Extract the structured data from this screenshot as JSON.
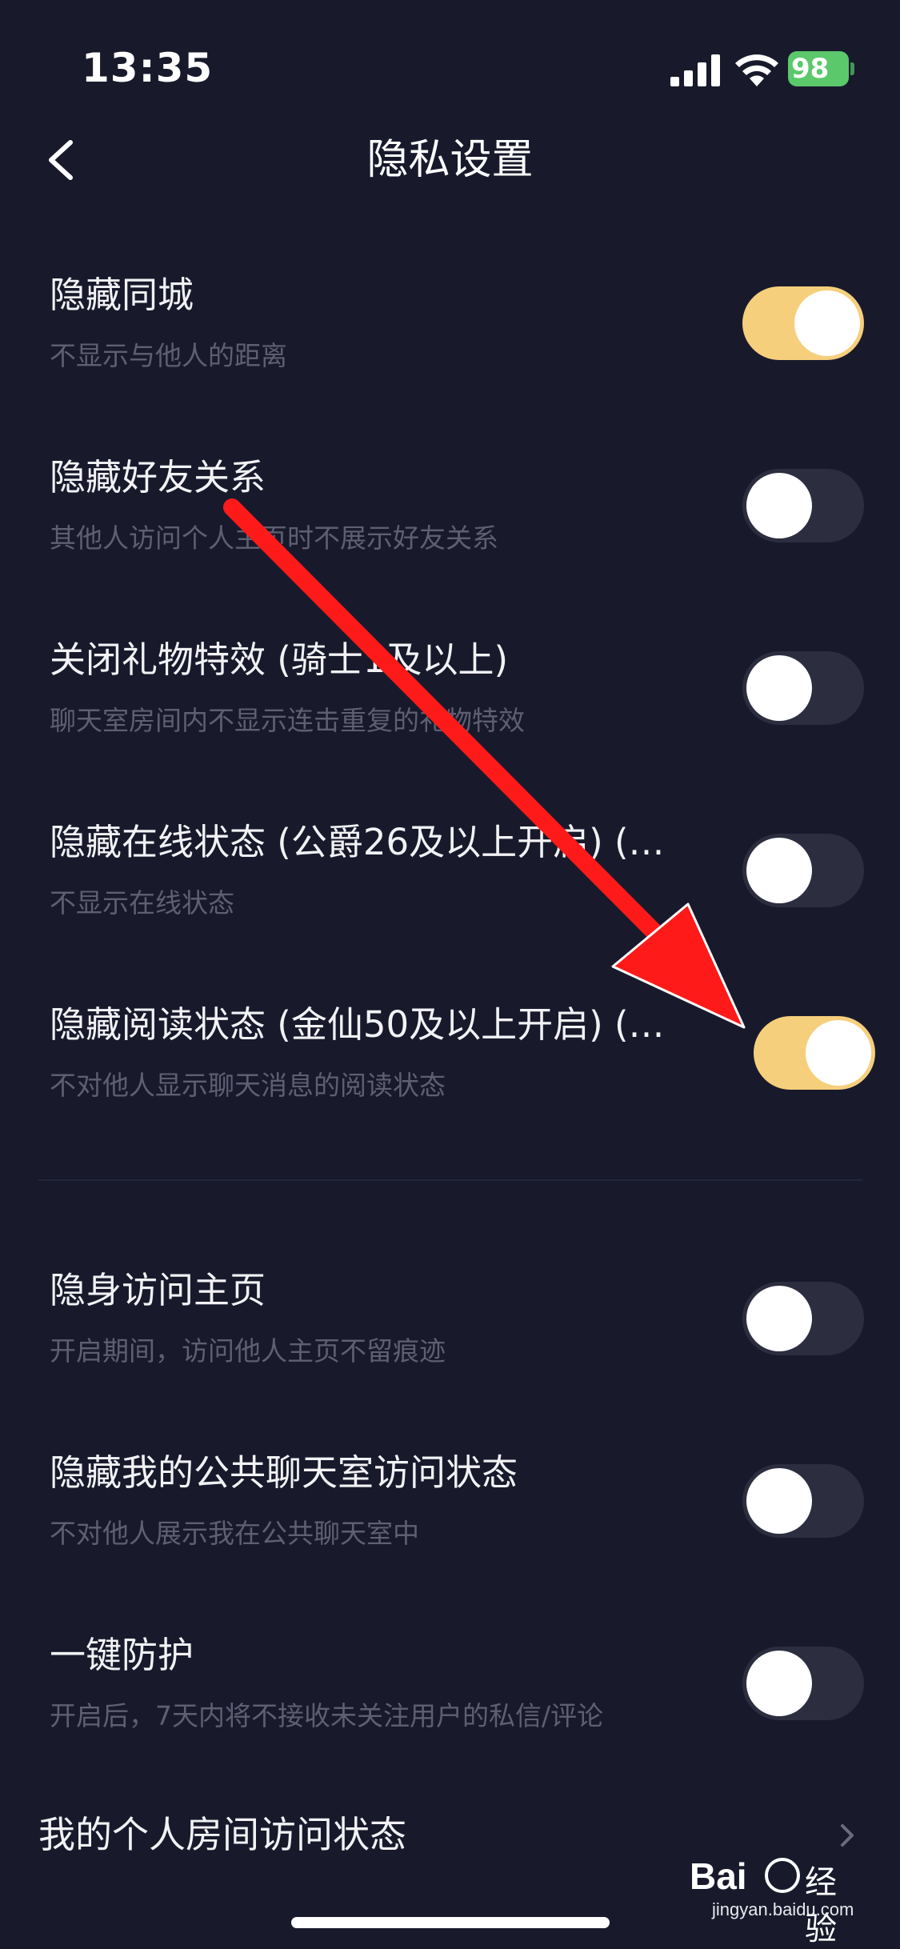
{
  "status_bar": {
    "time": "13:35",
    "battery": "98"
  },
  "header": {
    "title": "隐私设置"
  },
  "settings": [
    {
      "title": "隐藏同城",
      "subtitle": "不显示与他人的距离",
      "enabled": true
    },
    {
      "title": "隐藏好友关系",
      "subtitle": "其他人访问个人主页时不展示好友关系",
      "enabled": false
    },
    {
      "title": "关闭礼物特效 (骑士1及以上)",
      "subtitle": "聊天室房间内不显示连击重复的礼物特效",
      "enabled": false
    },
    {
      "title": "隐藏在线状态 (公爵26及以上开启) (…",
      "subtitle": "不显示在线状态",
      "enabled": false
    },
    {
      "title": "隐藏阅读状态 (金仙50及以上开启) (…",
      "subtitle": "不对他人显示聊天消息的阅读状态",
      "enabled": true
    },
    {
      "title": "隐身访问主页",
      "subtitle": "开启期间，访问他人主页不留痕迹",
      "enabled": false
    },
    {
      "title": "隐藏我的公共聊天室访问状态",
      "subtitle": "不对他人展示我在公共聊天室中",
      "enabled": false
    },
    {
      "title": "一键防护",
      "subtitle": "开启后，7天内将不接收未关注用户的私信/评论",
      "enabled": false
    }
  ],
  "link_row": {
    "label": "我的个人房间访问状态"
  },
  "watermark": {
    "brand": "Bai",
    "suffix": "经验",
    "url": "jingyan.baidu.com"
  },
  "colors": {
    "background": "#181a2c",
    "toggle_on": "#f6cf7c",
    "toggle_off": "#2c2e40",
    "arrow": "#ff1a1a"
  }
}
